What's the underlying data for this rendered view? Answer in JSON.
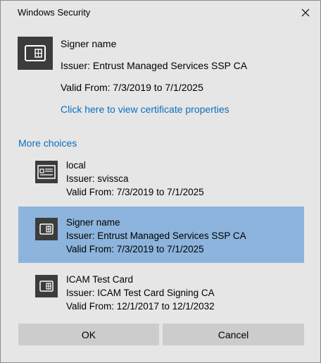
{
  "window": {
    "title": "Windows Security",
    "close_icon": "close-icon"
  },
  "selected_certificate": {
    "name": "Signer name",
    "issuer": "Issuer: Entrust Managed Services SSP CA",
    "valid": "Valid From: 7/3/2019 to 7/1/2025",
    "properties_link": "Click here to view certificate properties",
    "icon": "smart-card-icon"
  },
  "more_choices_label": "More choices",
  "choices": [
    {
      "name": "local",
      "issuer": "Issuer: svissca",
      "valid": "Valid From: 7/3/2019 to 7/1/2025",
      "icon": "certificate-icon",
      "selected": false
    },
    {
      "name": "Signer name",
      "issuer": "Issuer: Entrust Managed Services SSP CA",
      "valid": "Valid From: 7/3/2019 to 7/1/2025",
      "icon": "smart-card-icon",
      "selected": true
    },
    {
      "name": "ICAM Test Card",
      "issuer": "Issuer: ICAM Test Card Signing CA",
      "valid": "Valid From: 12/1/2017 to 12/1/2032",
      "icon": "smart-card-icon",
      "selected": false
    }
  ],
  "buttons": {
    "ok": "OK",
    "cancel": "Cancel"
  },
  "colors": {
    "background": "#e6e6e6",
    "selected_row": "#8cb4dc",
    "link": "#0a6fbf",
    "icon_tile": "#3c3c3c",
    "button": "#cccccc"
  }
}
